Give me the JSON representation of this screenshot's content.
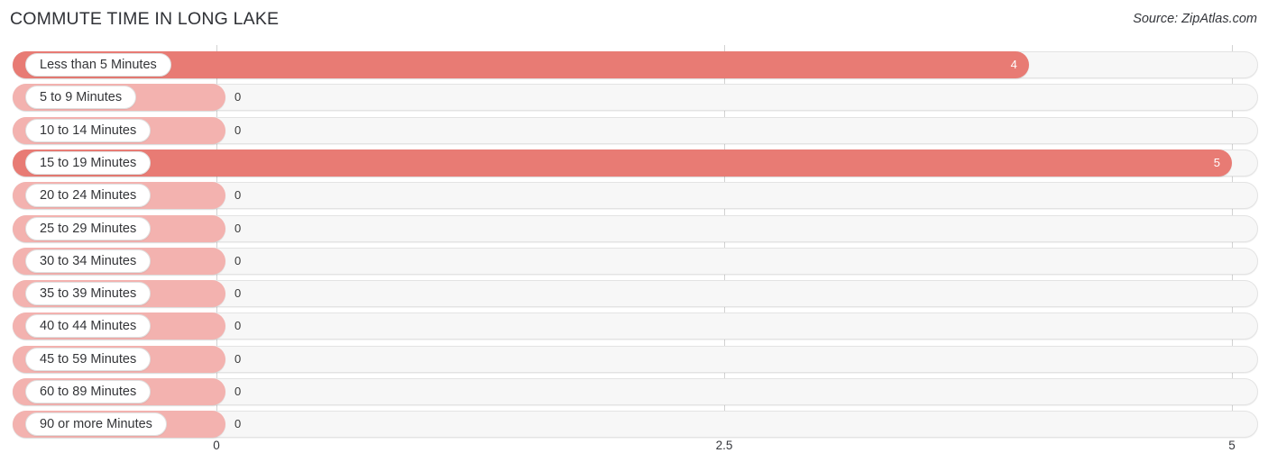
{
  "header": {
    "title": "COMMUTE TIME IN LONG LAKE",
    "source": "Source: ZipAtlas.com"
  },
  "colors": {
    "bar_value": "#e87b74",
    "bar_zero": "#f3b2af",
    "track": "#f7f7f7",
    "gridline": "#d2d2d2",
    "title_text": "#2f3136"
  },
  "chart_data": {
    "type": "bar",
    "orientation": "horizontal",
    "title": "COMMUTE TIME IN LONG LAKE",
    "xlabel": "",
    "ylabel": "",
    "xlim": [
      0,
      5
    ],
    "grid": true,
    "legend": false,
    "ticks": [
      {
        "label": "0",
        "value": 0
      },
      {
        "label": "2.5",
        "value": 2.5
      },
      {
        "label": "5",
        "value": 5
      }
    ],
    "categories": [
      "Less than 5 Minutes",
      "5 to 9 Minutes",
      "10 to 14 Minutes",
      "15 to 19 Minutes",
      "20 to 24 Minutes",
      "25 to 29 Minutes",
      "30 to 34 Minutes",
      "35 to 39 Minutes",
      "40 to 44 Minutes",
      "45 to 59 Minutes",
      "60 to 89 Minutes",
      "90 or more Minutes"
    ],
    "values": [
      4,
      0,
      0,
      5,
      0,
      0,
      0,
      0,
      0,
      0,
      0,
      0
    ],
    "value_labels": [
      "4",
      "0",
      "0",
      "5",
      "0",
      "0",
      "0",
      "0",
      "0",
      "0",
      "0",
      "0"
    ]
  }
}
